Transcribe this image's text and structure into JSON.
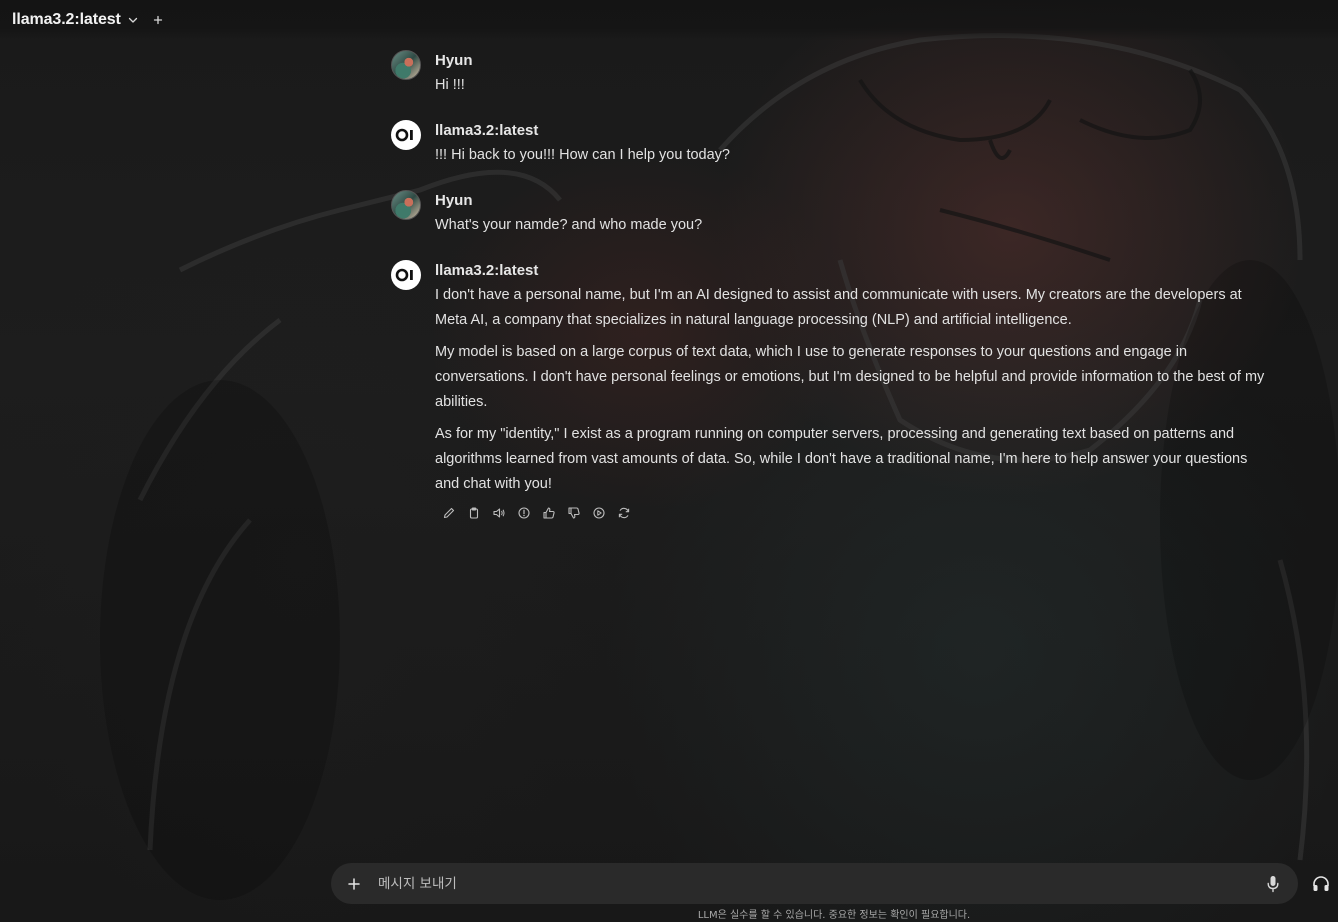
{
  "header": {
    "model_name": "llama3.2:latest",
    "model_dropdown_icon": "chevron-down-icon",
    "new_chat_icon": "plus-icon"
  },
  "messages": [
    {
      "role": "user",
      "sender": "Hyun",
      "paragraphs": [
        "Hi !!!"
      ]
    },
    {
      "role": "assistant",
      "sender": "llama3.2:latest",
      "paragraphs": [
        "!!! Hi back to you!!! How can I help you today?"
      ]
    },
    {
      "role": "user",
      "sender": "Hyun",
      "paragraphs": [
        "What's your namde? and who made you?"
      ]
    },
    {
      "role": "assistant",
      "sender": "llama3.2:latest",
      "paragraphs": [
        "I don't have a personal name, but I'm an AI designed to assist and communicate with users. My creators are the developers at Meta AI, a company that specializes in natural language processing (NLP) and artificial intelligence.",
        "My model is based on a large corpus of text data, which I use to generate responses to your questions and engage in conversations. I don't have personal feelings or emotions, but I'm designed to be helpful and provide information to the best of my abilities.",
        "As for my \"identity,\" I exist as a program running on computer servers, processing and generating text based on patterns and algorithms learned from vast amounts of data. So, while I don't have a traditional name, I'm here to help answer your questions and chat with you!"
      ],
      "actions": [
        "edit-icon",
        "copy-icon",
        "read-aloud-icon",
        "info-icon",
        "thumbs-up-icon",
        "thumbs-down-icon",
        "continue-icon",
        "regenerate-icon"
      ]
    }
  ],
  "composer": {
    "placeholder": "메시지 보내기",
    "add_icon": "plus-icon",
    "mic_icon": "microphone-icon",
    "call_icon": "headphones-icon"
  },
  "footer": {
    "disclaimer": "LLM은 실수를 할 수 있습니다. 중요한 정보는 확인이 필요합니다."
  },
  "colors": {
    "background": "#171717",
    "composer_bg": "#2a2a2a",
    "text": "#e2e2e2"
  }
}
